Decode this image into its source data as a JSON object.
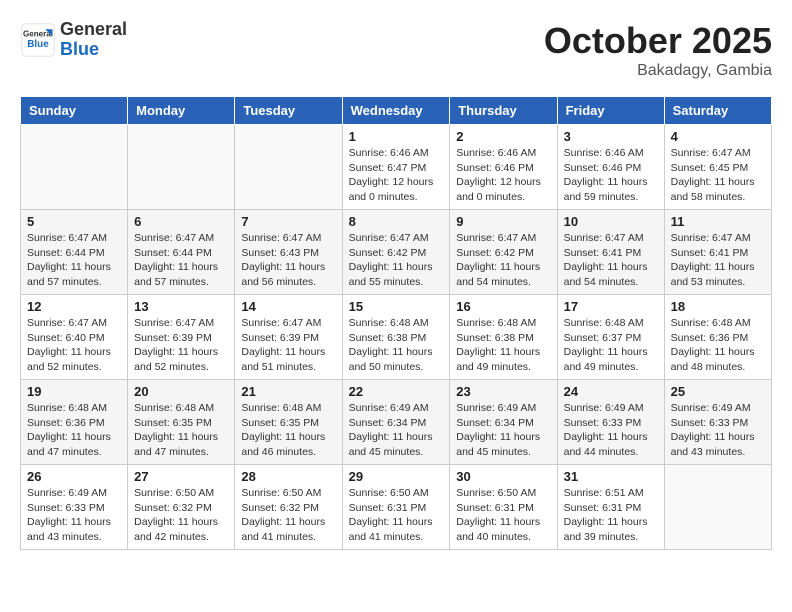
{
  "header": {
    "logo_general": "General",
    "logo_blue": "Blue",
    "month": "October 2025",
    "location": "Bakadagy, Gambia"
  },
  "days_of_week": [
    "Sunday",
    "Monday",
    "Tuesday",
    "Wednesday",
    "Thursday",
    "Friday",
    "Saturday"
  ],
  "weeks": [
    [
      {
        "day": "",
        "info": ""
      },
      {
        "day": "",
        "info": ""
      },
      {
        "day": "",
        "info": ""
      },
      {
        "day": "1",
        "info": "Sunrise: 6:46 AM\nSunset: 6:47 PM\nDaylight: 12 hours\nand 0 minutes."
      },
      {
        "day": "2",
        "info": "Sunrise: 6:46 AM\nSunset: 6:46 PM\nDaylight: 12 hours\nand 0 minutes."
      },
      {
        "day": "3",
        "info": "Sunrise: 6:46 AM\nSunset: 6:46 PM\nDaylight: 11 hours\nand 59 minutes."
      },
      {
        "day": "4",
        "info": "Sunrise: 6:47 AM\nSunset: 6:45 PM\nDaylight: 11 hours\nand 58 minutes."
      }
    ],
    [
      {
        "day": "5",
        "info": "Sunrise: 6:47 AM\nSunset: 6:44 PM\nDaylight: 11 hours\nand 57 minutes."
      },
      {
        "day": "6",
        "info": "Sunrise: 6:47 AM\nSunset: 6:44 PM\nDaylight: 11 hours\nand 57 minutes."
      },
      {
        "day": "7",
        "info": "Sunrise: 6:47 AM\nSunset: 6:43 PM\nDaylight: 11 hours\nand 56 minutes."
      },
      {
        "day": "8",
        "info": "Sunrise: 6:47 AM\nSunset: 6:42 PM\nDaylight: 11 hours\nand 55 minutes."
      },
      {
        "day": "9",
        "info": "Sunrise: 6:47 AM\nSunset: 6:42 PM\nDaylight: 11 hours\nand 54 minutes."
      },
      {
        "day": "10",
        "info": "Sunrise: 6:47 AM\nSunset: 6:41 PM\nDaylight: 11 hours\nand 54 minutes."
      },
      {
        "day": "11",
        "info": "Sunrise: 6:47 AM\nSunset: 6:41 PM\nDaylight: 11 hours\nand 53 minutes."
      }
    ],
    [
      {
        "day": "12",
        "info": "Sunrise: 6:47 AM\nSunset: 6:40 PM\nDaylight: 11 hours\nand 52 minutes."
      },
      {
        "day": "13",
        "info": "Sunrise: 6:47 AM\nSunset: 6:39 PM\nDaylight: 11 hours\nand 52 minutes."
      },
      {
        "day": "14",
        "info": "Sunrise: 6:47 AM\nSunset: 6:39 PM\nDaylight: 11 hours\nand 51 minutes."
      },
      {
        "day": "15",
        "info": "Sunrise: 6:48 AM\nSunset: 6:38 PM\nDaylight: 11 hours\nand 50 minutes."
      },
      {
        "day": "16",
        "info": "Sunrise: 6:48 AM\nSunset: 6:38 PM\nDaylight: 11 hours\nand 49 minutes."
      },
      {
        "day": "17",
        "info": "Sunrise: 6:48 AM\nSunset: 6:37 PM\nDaylight: 11 hours\nand 49 minutes."
      },
      {
        "day": "18",
        "info": "Sunrise: 6:48 AM\nSunset: 6:36 PM\nDaylight: 11 hours\nand 48 minutes."
      }
    ],
    [
      {
        "day": "19",
        "info": "Sunrise: 6:48 AM\nSunset: 6:36 PM\nDaylight: 11 hours\nand 47 minutes."
      },
      {
        "day": "20",
        "info": "Sunrise: 6:48 AM\nSunset: 6:35 PM\nDaylight: 11 hours\nand 47 minutes."
      },
      {
        "day": "21",
        "info": "Sunrise: 6:48 AM\nSunset: 6:35 PM\nDaylight: 11 hours\nand 46 minutes."
      },
      {
        "day": "22",
        "info": "Sunrise: 6:49 AM\nSunset: 6:34 PM\nDaylight: 11 hours\nand 45 minutes."
      },
      {
        "day": "23",
        "info": "Sunrise: 6:49 AM\nSunset: 6:34 PM\nDaylight: 11 hours\nand 45 minutes."
      },
      {
        "day": "24",
        "info": "Sunrise: 6:49 AM\nSunset: 6:33 PM\nDaylight: 11 hours\nand 44 minutes."
      },
      {
        "day": "25",
        "info": "Sunrise: 6:49 AM\nSunset: 6:33 PM\nDaylight: 11 hours\nand 43 minutes."
      }
    ],
    [
      {
        "day": "26",
        "info": "Sunrise: 6:49 AM\nSunset: 6:33 PM\nDaylight: 11 hours\nand 43 minutes."
      },
      {
        "day": "27",
        "info": "Sunrise: 6:50 AM\nSunset: 6:32 PM\nDaylight: 11 hours\nand 42 minutes."
      },
      {
        "day": "28",
        "info": "Sunrise: 6:50 AM\nSunset: 6:32 PM\nDaylight: 11 hours\nand 41 minutes."
      },
      {
        "day": "29",
        "info": "Sunrise: 6:50 AM\nSunset: 6:31 PM\nDaylight: 11 hours\nand 41 minutes."
      },
      {
        "day": "30",
        "info": "Sunrise: 6:50 AM\nSunset: 6:31 PM\nDaylight: 11 hours\nand 40 minutes."
      },
      {
        "day": "31",
        "info": "Sunrise: 6:51 AM\nSunset: 6:31 PM\nDaylight: 11 hours\nand 39 minutes."
      },
      {
        "day": "",
        "info": ""
      }
    ]
  ]
}
